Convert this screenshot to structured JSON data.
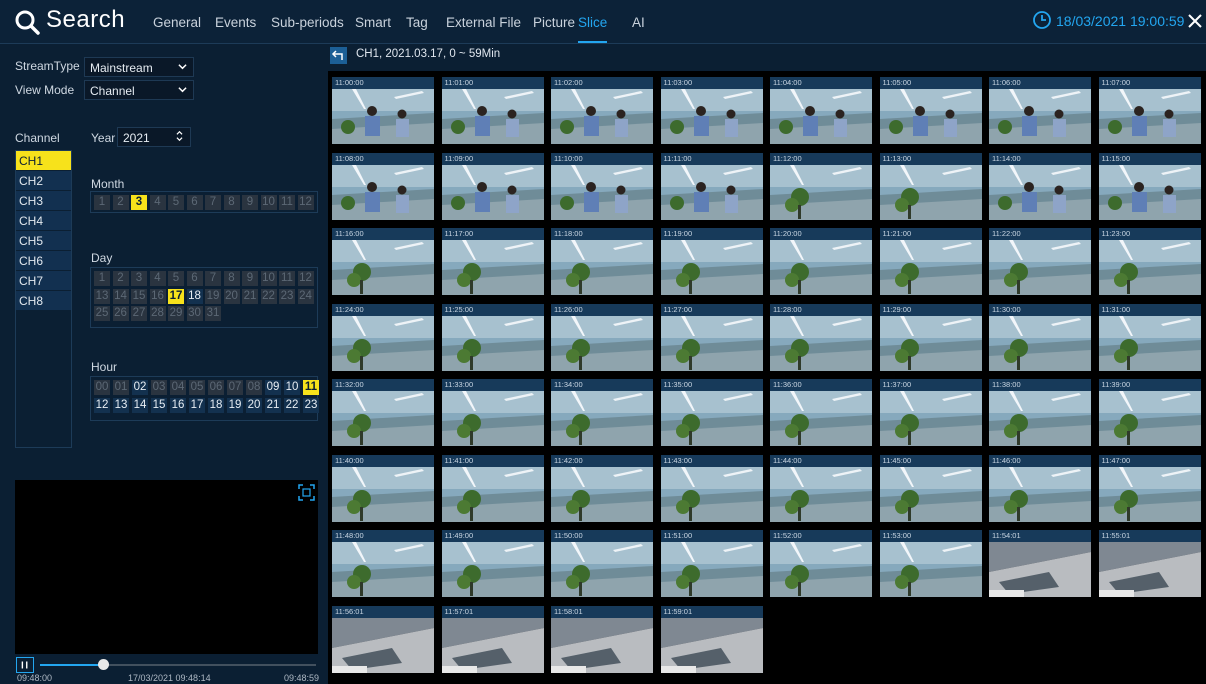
{
  "app": {
    "title": "Search",
    "datetime": "18/03/2021 19:00:59"
  },
  "tabs": [
    "General",
    "Events",
    "Sub-periods",
    "Smart",
    "Tag",
    "External File",
    "Picture",
    "Slice",
    "AI"
  ],
  "active_tab": "Slice",
  "left": {
    "stream_type_label": "StreamType",
    "stream_type_value": "Mainstream",
    "view_mode_label": "View Mode",
    "view_mode_value": "Channel",
    "channel_label": "Channel",
    "year_label": "Year",
    "year_value": "2021",
    "month_label": "Month",
    "day_label": "Day",
    "hour_label": "Hour",
    "channels": [
      "CH1",
      "CH2",
      "CH3",
      "CH4",
      "CH5",
      "CH6",
      "CH7",
      "CH8"
    ],
    "selected_channel": "CH1"
  },
  "months": {
    "values": [
      "1",
      "2",
      "3",
      "4",
      "5",
      "6",
      "7",
      "8",
      "9",
      "10",
      "11",
      "12"
    ],
    "available": [
      "3"
    ],
    "selected": "3"
  },
  "days": {
    "values": [
      "1",
      "2",
      "3",
      "4",
      "5",
      "6",
      "7",
      "8",
      "9",
      "10",
      "11",
      "12",
      "13",
      "14",
      "15",
      "16",
      "17",
      "18",
      "19",
      "20",
      "21",
      "22",
      "23",
      "24",
      "25",
      "26",
      "27",
      "28",
      "29",
      "30",
      "31"
    ],
    "available": [
      "17",
      "18"
    ],
    "selected": "17"
  },
  "hours": {
    "values": [
      "00",
      "01",
      "02",
      "03",
      "04",
      "05",
      "06",
      "07",
      "08",
      "09",
      "10",
      "11",
      "12",
      "13",
      "14",
      "15",
      "16",
      "17",
      "18",
      "19",
      "20",
      "21",
      "22",
      "23"
    ],
    "available": [
      "02",
      "09",
      "10",
      "11",
      "12",
      "13",
      "14",
      "15",
      "16",
      "17",
      "18",
      "19",
      "20",
      "21",
      "22",
      "23"
    ],
    "selected": "11"
  },
  "playback": {
    "start_time": "09:48:00",
    "current": "17/03/2021 09:48:14",
    "end_time": "09:48:59",
    "progress": 0.23
  },
  "slice": {
    "info": "CH1,  2021.03.17,  0 ~ 59Min",
    "thumbnails": [
      {
        "time": "11:00:00",
        "scene": "people"
      },
      {
        "time": "11:01:00",
        "scene": "people"
      },
      {
        "time": "11:02:00",
        "scene": "people"
      },
      {
        "time": "11:03:00",
        "scene": "people"
      },
      {
        "time": "11:04:00",
        "scene": "people"
      },
      {
        "time": "11:05:00",
        "scene": "people"
      },
      {
        "time": "11:06:00",
        "scene": "people"
      },
      {
        "time": "11:07:00",
        "scene": "people"
      },
      {
        "time": "11:08:00",
        "scene": "people"
      },
      {
        "time": "11:09:00",
        "scene": "people"
      },
      {
        "time": "11:10:00",
        "scene": "people"
      },
      {
        "time": "11:11:00",
        "scene": "people"
      },
      {
        "time": "11:12:00",
        "scene": "plant"
      },
      {
        "time": "11:13:00",
        "scene": "plant"
      },
      {
        "time": "11:14:00",
        "scene": "people"
      },
      {
        "time": "11:15:00",
        "scene": "people"
      },
      {
        "time": "11:16:00",
        "scene": "plant"
      },
      {
        "time": "11:17:00",
        "scene": "plant"
      },
      {
        "time": "11:18:00",
        "scene": "plant"
      },
      {
        "time": "11:19:00",
        "scene": "plant"
      },
      {
        "time": "11:20:00",
        "scene": "plant"
      },
      {
        "time": "11:21:00",
        "scene": "plant"
      },
      {
        "time": "11:22:00",
        "scene": "plant"
      },
      {
        "time": "11:23:00",
        "scene": "plant"
      },
      {
        "time": "11:24:00",
        "scene": "plant"
      },
      {
        "time": "11:25:00",
        "scene": "plant"
      },
      {
        "time": "11:26:00",
        "scene": "plant"
      },
      {
        "time": "11:27:00",
        "scene": "plant"
      },
      {
        "time": "11:28:00",
        "scene": "plant"
      },
      {
        "time": "11:29:00",
        "scene": "plant"
      },
      {
        "time": "11:30:00",
        "scene": "plant"
      },
      {
        "time": "11:31:00",
        "scene": "plant"
      },
      {
        "time": "11:32:00",
        "scene": "plant"
      },
      {
        "time": "11:33:00",
        "scene": "plant"
      },
      {
        "time": "11:34:00",
        "scene": "plant"
      },
      {
        "time": "11:35:00",
        "scene": "plant"
      },
      {
        "time": "11:36:00",
        "scene": "plant"
      },
      {
        "time": "11:37:00",
        "scene": "plant"
      },
      {
        "time": "11:38:00",
        "scene": "plant"
      },
      {
        "time": "11:39:00",
        "scene": "plant"
      },
      {
        "time": "11:40:00",
        "scene": "plant"
      },
      {
        "time": "11:41:00",
        "scene": "plant"
      },
      {
        "time": "11:42:00",
        "scene": "plant"
      },
      {
        "time": "11:43:00",
        "scene": "plant"
      },
      {
        "time": "11:44:00",
        "scene": "plant"
      },
      {
        "time": "11:45:00",
        "scene": "plant"
      },
      {
        "time": "11:46:00",
        "scene": "plant"
      },
      {
        "time": "11:47:00",
        "scene": "plant"
      },
      {
        "time": "11:48:00",
        "scene": "plant"
      },
      {
        "time": "11:49:00",
        "scene": "plant"
      },
      {
        "time": "11:50:00",
        "scene": "plant"
      },
      {
        "time": "11:51:00",
        "scene": "plant"
      },
      {
        "time": "11:52:00",
        "scene": "plant"
      },
      {
        "time": "11:53:00",
        "scene": "plant"
      },
      {
        "time": "11:54:01",
        "scene": "floor"
      },
      {
        "time": "11:55:01",
        "scene": "floor"
      },
      {
        "time": "11:56:01",
        "scene": "floor"
      },
      {
        "time": "11:57:01",
        "scene": "floor"
      },
      {
        "time": "11:58:01",
        "scene": "floor"
      },
      {
        "time": "11:59:01",
        "scene": "floor"
      }
    ]
  },
  "colors": {
    "accent": "#23a6f0",
    "selected": "#f7e21b",
    "background": "#0b1f33"
  },
  "icons": [
    "search-icon",
    "clock-icon",
    "close-icon",
    "chevron-down-icon",
    "spin-icon",
    "fullscreen-icon",
    "pause-icon",
    "back-arrow-icon"
  ]
}
